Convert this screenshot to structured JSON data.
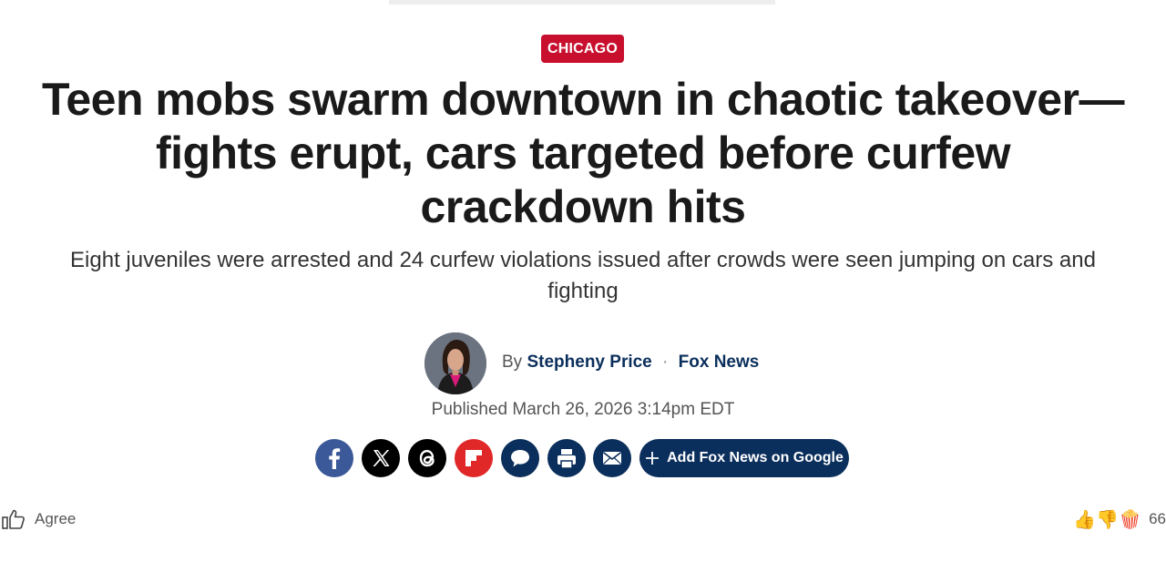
{
  "article": {
    "category": "CHICAGO",
    "headline": "Teen mobs swarm downtown in chaotic takeover—fights erupt, cars targeted before curfew crackdown hits",
    "subheadline": "Eight juveniles were arrested and 24 curfew violations issued after crowds were seen jumping on cars and fighting",
    "byline_prefix": "By",
    "author": "Stepheny Price",
    "separator": "·",
    "outlet": "Fox News",
    "published": "Published March 26, 2026 3:14pm EDT"
  },
  "share": {
    "icons": [
      "facebook-icon",
      "x-icon",
      "threads-icon",
      "flipboard-icon",
      "comment-icon",
      "print-icon",
      "email-icon"
    ],
    "google_label": "Add Fox News on Google"
  },
  "footer": {
    "agree_label": "Agree",
    "reaction_count": "66"
  },
  "colors": {
    "badge": "#c8102e",
    "navy": "#0b2f5c",
    "facebook": "#3b5998",
    "flipboard": "#e12828"
  }
}
